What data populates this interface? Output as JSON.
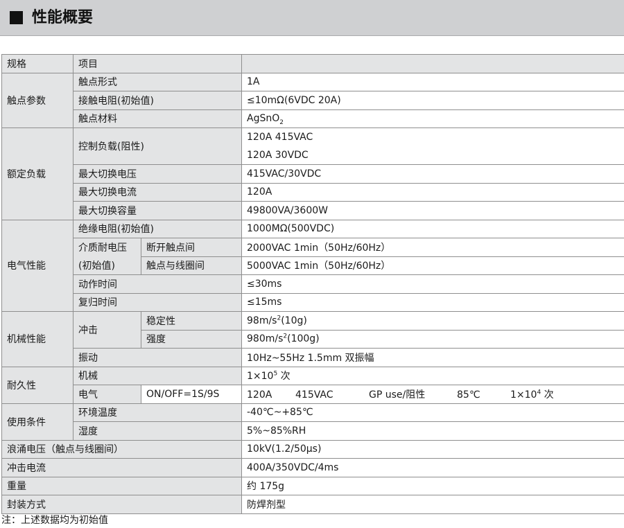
{
  "header": {
    "title": "性能概要"
  },
  "table": {
    "col_spec": "规格",
    "col_item": "项目",
    "contact": {
      "label": "触点参数",
      "form_label": "触点形式",
      "form_value": "1A",
      "resistance_label": "接触电阻(初始值)",
      "resistance_value": "≤10mΩ(6VDC 20A)",
      "material_label": "触点材料",
      "material_value": "AgSnO",
      "material_sub": "2"
    },
    "rated": {
      "label": "额定负载",
      "control_label": "控制负载(阻性)",
      "control_value_1": "120A   415VAC",
      "control_value_2": "120A   30VDC",
      "max_voltage_label": "最大切换电压",
      "max_voltage_value": "415VAC/30VDC",
      "max_current_label": "最大切换电流",
      "max_current_value": "120A",
      "max_capacity_label": "最大切换容量",
      "max_capacity_value": "49800VA/3600W"
    },
    "electrical": {
      "label": "电气性能",
      "insulation_label": "绝缘电阻(初始值)",
      "insulation_value": "1000MΩ(500VDC)",
      "dielectric_label_1": "介质耐电压",
      "dielectric_label_2": "(初始值)",
      "open_label": "断开触点间",
      "open_value": "2000VAC   1min（50Hz/60Hz）",
      "coil_label": "触点与线圈间",
      "coil_value": "5000VAC   1min（50Hz/60Hz）",
      "operate_label": "动作时间",
      "operate_value": "≤30ms",
      "release_label": "复归时间",
      "release_value": "≤15ms"
    },
    "mechanical": {
      "label": "机械性能",
      "shock_label": "冲击",
      "stability_label": "稳定性",
      "stability_value": "98m/s",
      "stability_sup": "2",
      "stability_tail": "(10g)",
      "strength_label": "强度",
      "strength_value": "980m/s",
      "strength_sup": "2",
      "strength_tail": "(100g)",
      "vibration_label": "振动",
      "vibration_value": "10Hz~55Hz 1.5mm  双振幅"
    },
    "endurance": {
      "label": "耐久性",
      "mech_label": "机械",
      "mech_value": "1×10",
      "mech_sup": "5",
      "mech_tail": " 次",
      "elec_label": "电气",
      "elec_cond": "ON/OFF=1S/9S",
      "elec_current": "120A",
      "elec_voltage": "415VAC",
      "elec_load": "GP use/阻性",
      "elec_temp": "85℃",
      "elec_count": "1×10",
      "elec_count_sup": "4",
      "elec_count_tail": " 次"
    },
    "conditions": {
      "label": "使用条件",
      "temp_label": "环境温度",
      "temp_value": "-40℃~+85℃",
      "humidity_label": "湿度",
      "humidity_value": "5%~85%RH"
    },
    "surge": {
      "label": "浪涌电压（触点与线圈间）",
      "value": "10kV(1.2/50μs)"
    },
    "impulse": {
      "label": "冲击电流",
      "value": "400A/350VDC/4ms"
    },
    "weight": {
      "label": "重量",
      "value": "约 175g"
    },
    "package": {
      "label": "封装方式",
      "value": "防焊剂型"
    }
  },
  "note": "注：上述数据均为初始值"
}
